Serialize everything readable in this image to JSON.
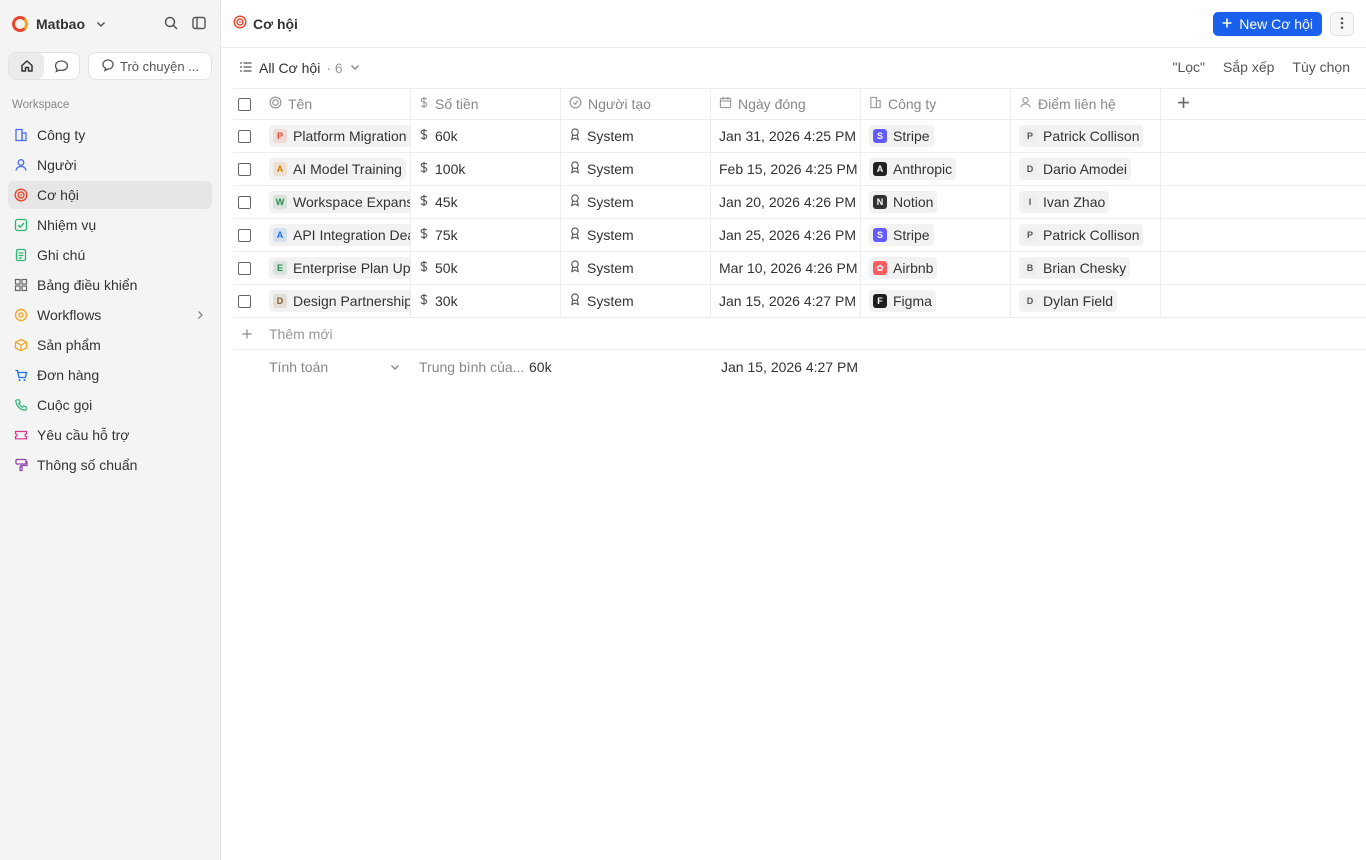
{
  "workspace": {
    "name": "Matbao"
  },
  "sidebar": {
    "chat_label": "Trò chuyện ...",
    "section_label": "Workspace",
    "items": [
      {
        "label": "Công ty",
        "icon": "building-icon",
        "color": "#4a6cf7"
      },
      {
        "label": "Người",
        "icon": "user-icon",
        "color": "#4a6cf7"
      },
      {
        "label": "Cơ hội",
        "icon": "target-icon",
        "color": "#e8452c",
        "active": true
      },
      {
        "label": "Nhiệm vụ",
        "icon": "check-square-icon",
        "color": "#2bb673"
      },
      {
        "label": "Ghi chú",
        "icon": "note-icon",
        "color": "#2bb673"
      },
      {
        "label": "Bảng điều khiển",
        "icon": "dashboard-icon",
        "color": "#666666"
      },
      {
        "label": "Workflows",
        "icon": "workflow-icon",
        "color": "#f5a623"
      },
      {
        "label": "Sản phẩm",
        "icon": "box-icon",
        "color": "#f5a623"
      },
      {
        "label": "Đơn hàng",
        "icon": "cart-icon",
        "color": "#1a73e8"
      },
      {
        "label": "Cuộc gọi",
        "icon": "phone-icon",
        "color": "#2bb673"
      },
      {
        "label": "Yêu cầu hỗ trợ",
        "icon": "ticket-icon",
        "color": "#d6338c"
      },
      {
        "label": "Thông số chuẩn",
        "icon": "paint-icon",
        "color": "#8e44ad"
      }
    ]
  },
  "header": {
    "title": "Cơ hội",
    "new_button": "New Cơ hội"
  },
  "view": {
    "name": "All Cơ hội",
    "count": "· 6",
    "filter": "\"Lọc\"",
    "sort": "Sắp xếp",
    "options": "Tùy chọn"
  },
  "columns": {
    "name": "Tên",
    "amount": "Số tiền",
    "creator": "Người tạo",
    "close_date": "Ngày đóng",
    "company": "Công ty",
    "contact": "Điểm liên hệ"
  },
  "rows": [
    {
      "initial": "P",
      "initial_color": "#e8452c",
      "name": "Platform Migration",
      "amount": "60k",
      "creator": "System",
      "date": "Jan 31, 2026 4:25 PM",
      "company": "Stripe",
      "company_logo": "S",
      "company_color": "#635bff",
      "contact_initial": "P",
      "contact": "Patrick Collison"
    },
    {
      "initial": "A",
      "initial_color": "#d67a00",
      "name": "AI Model Training",
      "amount": "100k",
      "creator": "System",
      "date": "Feb 15, 2026 4:25 PM",
      "company": "Anthropic",
      "company_logo": "A",
      "company_color": "#222222",
      "contact_initial": "D",
      "contact": "Dario Amodei"
    },
    {
      "initial": "W",
      "initial_color": "#2d8a4e",
      "name": "Workspace Expansion",
      "amount": "45k",
      "creator": "System",
      "date": "Jan 20, 2026 4:26 PM",
      "company": "Notion",
      "company_logo": "N",
      "company_color": "#333333",
      "contact_initial": "I",
      "contact": "Ivan Zhao"
    },
    {
      "initial": "A",
      "initial_color": "#1a73e8",
      "name": "API Integration Deal",
      "amount": "75k",
      "creator": "System",
      "date": "Jan 25, 2026 4:26 PM",
      "company": "Stripe",
      "company_logo": "S",
      "company_color": "#635bff",
      "contact_initial": "P",
      "contact": "Patrick Collison"
    },
    {
      "initial": "E",
      "initial_color": "#2d8a4e",
      "name": "Enterprise Plan Upgrade",
      "amount": "50k",
      "creator": "System",
      "date": "Mar 10, 2026 4:26 PM",
      "company": "Airbnb",
      "company_logo": "✿",
      "company_color": "#ff5a5f",
      "contact_initial": "B",
      "contact": "Brian Chesky"
    },
    {
      "initial": "D",
      "initial_color": "#8a5a2d",
      "name": "Design Partnership",
      "amount": "30k",
      "creator": "System",
      "date": "Jan 15, 2026 4:27 PM",
      "company": "Figma",
      "company_logo": "F",
      "company_color": "#1e1e1e",
      "contact_initial": "D",
      "contact": "Dylan Field"
    }
  ],
  "footer": {
    "add_new": "Thêm mới",
    "calc_label": "Tính toán",
    "avg_label": "Trung bình của...",
    "avg_value": "60k",
    "date_value": "Jan 15, 2026 4:27 PM"
  },
  "colors": {
    "accent": "#1961ed",
    "brand": "#e8452c"
  }
}
